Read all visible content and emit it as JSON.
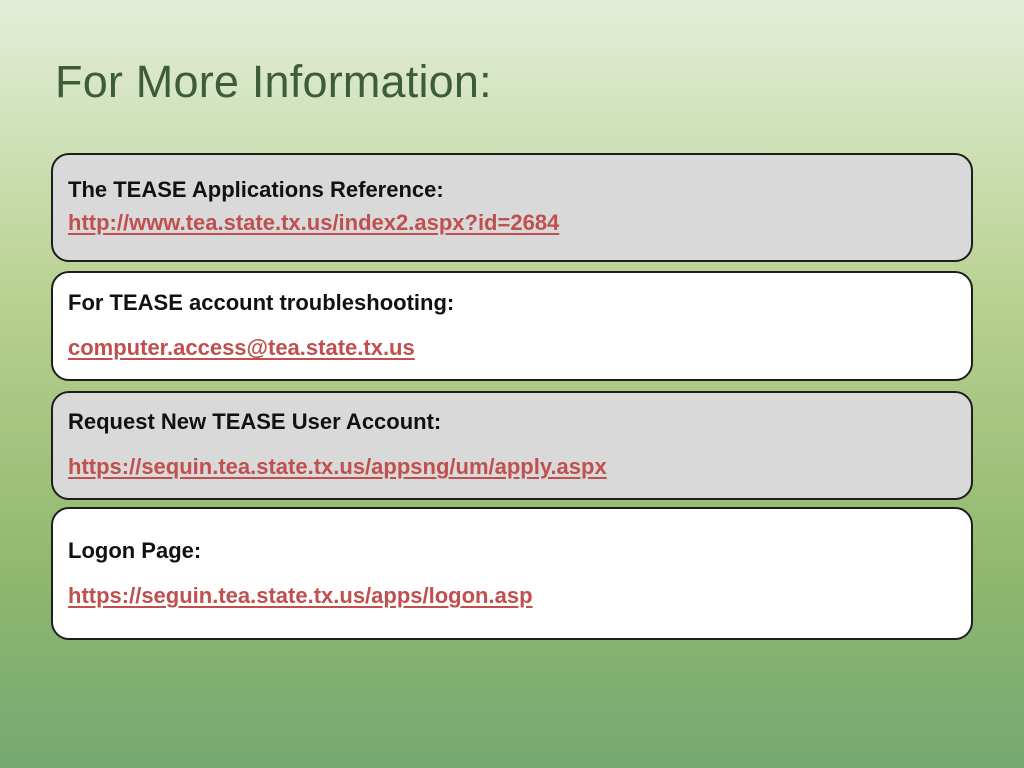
{
  "slide": {
    "title": "For More Information:"
  },
  "boxes": [
    {
      "label": "The TEASE Applications Reference:",
      "link": "http://www.tea.state.tx.us/index2.aspx?id=2684",
      "background": "#d9d9d9"
    },
    {
      "label": "For TEASE  account troubleshooting:",
      "link": "computer.access@tea.state.tx.us",
      "background": "#ffffff"
    },
    {
      "label": "Request New TEASE  User Account:",
      "link": "https://sequin.tea.state.tx.us/appsng/um/apply.aspx",
      "background": "#d9d9d9"
    },
    {
      "label": "Logon Page:",
      "link": "https://seguin.tea.state.tx.us/apps/logon.asp",
      "background": "#ffffff"
    }
  ],
  "colors": {
    "title": "#3d5c3a",
    "link": "#c0504d",
    "label": "#111111",
    "border": "#1e1e1e"
  }
}
